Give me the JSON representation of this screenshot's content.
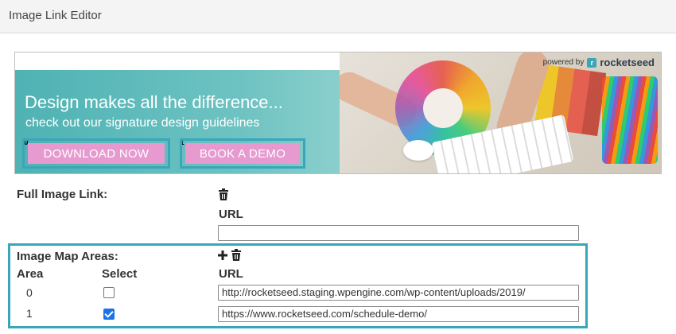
{
  "window": {
    "title": "Image Link Editor"
  },
  "banner": {
    "powered_by": "powered by",
    "brand": "rocketseed",
    "headline": "Design makes all the difference...",
    "subline": "check out our signature design guidelines",
    "areas": [
      {
        "index": "0",
        "cta": "DOWNLOAD NOW"
      },
      {
        "index": "1",
        "cta": "BOOK A DEMO"
      }
    ]
  },
  "full_image_link": {
    "label": "Full Image Link:",
    "url_header": "URL",
    "url_value": "",
    "delete_icon": "trash-icon"
  },
  "image_map_areas": {
    "label": "Image Map Areas:",
    "columns": {
      "area": "Area",
      "select": "Select",
      "url": "URL"
    },
    "add_icon": "plus-icon",
    "delete_icon": "trash-icon",
    "rows": [
      {
        "area": "0",
        "selected": false,
        "url": "http://rocketseed.staging.wpengine.com/wp-content/uploads/2019/"
      },
      {
        "area": "1",
        "selected": true,
        "url": "https://www.rocketseed.com/schedule-demo/"
      }
    ]
  },
  "colors": {
    "accent": "#3aa6b9",
    "cta_pink": "#e69ad0",
    "checkbox_checked": "#1a73e8"
  }
}
